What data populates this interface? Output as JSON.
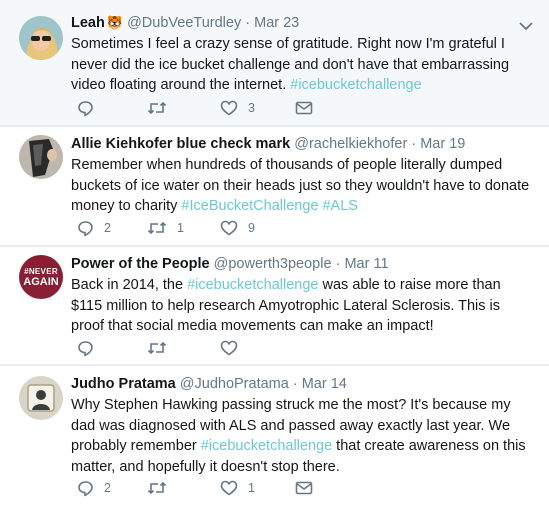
{
  "tweets": [
    {
      "name": "Leah",
      "badge": "🐯",
      "handle": "@DubVeeTurdley",
      "separator": "·",
      "date": "Mar 23",
      "text_parts": [
        "Sometimes I feel a crazy sense of gratitude. Right now I'm grateful I never did the ice bucket challenge and don't have that embarrassing video floating around the internet. ",
        "#icebucketchallenge"
      ],
      "replies": "",
      "retweets": "",
      "likes": "3"
    },
    {
      "name": "Allie Kiehkofer blue check mark",
      "handle": "@rachelkiekhofer",
      "separator": "·",
      "date": "Mar 19",
      "text_parts": [
        "Remember when hundreds of thousands of people literally dumped buckets of ice water on their heads just so they wouldn't have to donate money to charity ",
        "#IceBucketChallenge #ALS"
      ],
      "replies": "2",
      "retweets": "1",
      "likes": "9"
    },
    {
      "name": "Power of the People",
      "handle": "@powerth3people",
      "separator": "·",
      "date": "Mar 11",
      "avatar_text": [
        "#NEVER",
        "AGAIN"
      ],
      "text_parts": [
        "Back in 2014, the ",
        "#icebucketchallenge",
        " was able to raise more than $115 million to help research Amyotrophic Lateral Sclerosis. This is proof that social media movements can make an impact!"
      ],
      "replies": "",
      "retweets": "",
      "likes": ""
    },
    {
      "name": "Judho Pratama",
      "handle": "@JudhoPratama",
      "separator": "·",
      "date": "Mar 14",
      "text_parts": [
        "Why Stephen Hawking passing struck me the most? It's because my dad was diagnosed with ALS and passed away exactly last year. We probably remember ",
        "#icebucketchallenge",
        " that create awareness on this matter, and hopefully it doesn't stop there."
      ],
      "replies": "2",
      "retweets": "",
      "likes": "1"
    }
  ],
  "icons": [
    "reply-icon",
    "retweet-icon",
    "like-icon",
    "direct-message-icon",
    "caret-down-icon"
  ],
  "colors": {
    "hashtag": "#6bc8d3",
    "secondary": "#657786",
    "text": "#14171a",
    "never_again_bg": "#8a1f33"
  }
}
